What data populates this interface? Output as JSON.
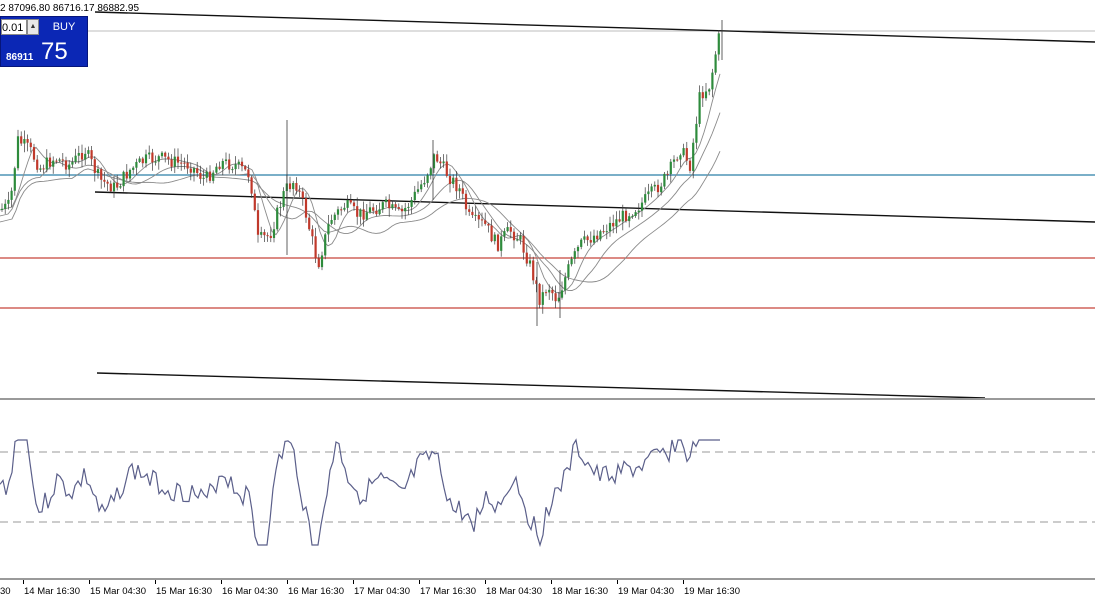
{
  "ohlc_text": "2 87096.80 86716.17 86882.95",
  "trade_panel": {
    "lot": "0.01",
    "spin_icon": "triangle-up-icon",
    "buy_label": "BUY",
    "price_small": "86911",
    "price_big": "75"
  },
  "time_axis": [
    {
      "label": "30"
    },
    {
      "label": "14 Mar 16:30"
    },
    {
      "label": "15 Mar 04:30"
    },
    {
      "label": "15 Mar 16:30"
    },
    {
      "label": "16 Mar 04:30"
    },
    {
      "label": "16 Mar 16:30"
    },
    {
      "label": "17 Mar 04:30"
    },
    {
      "label": "17 Mar 16:30"
    },
    {
      "label": "18 Mar 04:30"
    },
    {
      "label": "18 Mar 16:30"
    },
    {
      "label": "19 Mar 04:30"
    },
    {
      "label": "19 Mar 16:30"
    }
  ],
  "colors": {
    "bull_candle": "#2e8b3c",
    "bear_candle": "#c0392b",
    "wick": "#3a3a3a",
    "blue_level": "#2a7fa8",
    "red_level": "#c8453a",
    "trendline": "#111111",
    "ma_line": "#8a8a8a",
    "rsi_line": "#5b5f8a",
    "panel_blue": "#0b27b5"
  }
}
